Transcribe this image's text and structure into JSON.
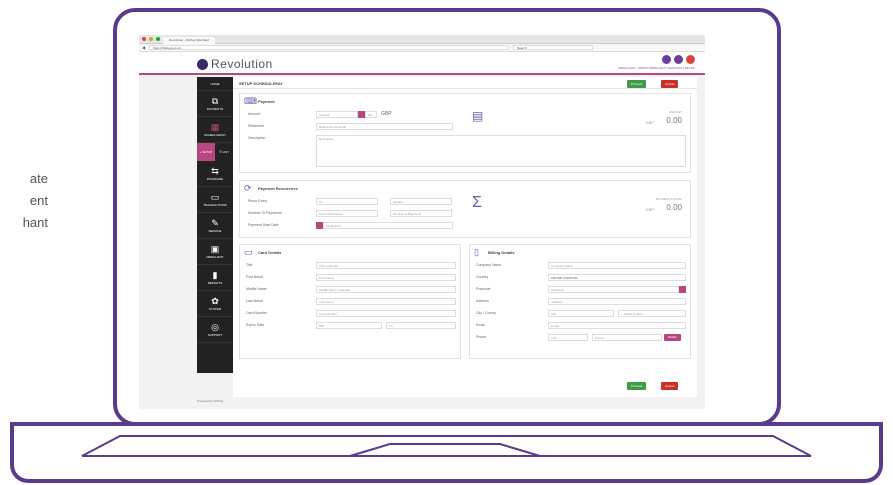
{
  "side_text": {
    "line1": "ate",
    "line2": "ent",
    "line3": "hant"
  },
  "browser": {
    "tab_label": "Revolution - WePay Merchant",
    "url": "https://Webpay.co.uk",
    "search_placeholder": "Search"
  },
  "header": {
    "logo_text": "Revolution",
    "merchant_label": "MERCHANT - WEPAY MERCHANT SERVICES LIMITED"
  },
  "sidebar": {
    "items": [
      {
        "label": "HOME",
        "icon": "home-icon"
      },
      {
        "label": "PAYMENTS",
        "icon": "payments-icon"
      },
      {
        "label": "SCHEDULEPAY",
        "icon": "calendar-icon"
      },
      {
        "label": "SETUP",
        "icon": "plus-icon"
      },
      {
        "label": "LIST",
        "icon": "list-icon"
      },
      {
        "label": "PAYAWARE",
        "icon": "shuffle-icon"
      },
      {
        "label": "TRANSACTIONS",
        "icon": "monitor-icon"
      },
      {
        "label": "SERVICE",
        "icon": "brush-icon"
      },
      {
        "label": "MERCHANT",
        "icon": "store-icon"
      },
      {
        "label": "REPORTS",
        "icon": "chart-icon"
      },
      {
        "label": "SYSTEM",
        "icon": "gear-icon"
      },
      {
        "label": "SUPPORT",
        "icon": "lifebuoy-icon"
      }
    ]
  },
  "page": {
    "title": "SETUP SCHEDULEPAY",
    "proceed": "Proceed",
    "cancel": "Cancel"
  },
  "payment": {
    "title": "Payment",
    "amount_label": "Amount",
    "amount_placeholder": "Amount",
    "decimals": "00",
    "currency": "GBP",
    "reference_label": "Reference",
    "reference_placeholder": "Reference (optional)",
    "description_label": "Description",
    "description_placeholder": "Description",
    "amount_title": "AMOUNT",
    "amount_value": "0.00",
    "amount_currency": "GBP"
  },
  "recurrence": {
    "title": "Payment Recurrence",
    "recur_label": "Recur Every",
    "recur_value": "01",
    "period_value": "Monthly",
    "num_label": "Number Of Payments",
    "num_value": "Fixed Recurrence",
    "num_placeholder": "Number of Payments",
    "start_label": "Payment Start Date",
    "start_value": "06-09-2017",
    "total_title": "PAYMENTS TOTAL",
    "total_value": "0.00",
    "total_currency": "GBP"
  },
  "card": {
    "title": "Card Details",
    "title_label": "Title",
    "title_placeholder": "Title (optional)",
    "first_label": "First Name",
    "first_placeholder": "First Name",
    "middle_label": "Middle Name",
    "middle_placeholder": "Middle Name (optional)",
    "last_label": "Last Name",
    "last_placeholder": "Last Name",
    "number_label": "Card Number",
    "number_placeholder": "Card Number",
    "expiry_label": "Expiry Date",
    "mm_placeholder": "MM",
    "yy_placeholder": "YY"
  },
  "billing": {
    "title": "Billing Details",
    "company_label": "Company Name",
    "company_placeholder": "Company Name",
    "country_label": "Country",
    "country_value": "UNITED KINGDOM",
    "postcode_label": "Postcode",
    "postcode_placeholder": "Postcode",
    "address_label": "Address",
    "address_placeholder": "Address",
    "city_label": "City / County",
    "city_placeholder": "City",
    "county_placeholder": "-- Select County --",
    "email_label": "Email",
    "email_placeholder": "Email",
    "phone_label": "Phone",
    "phone_code": "+44",
    "phone_placeholder": "Phone",
    "mobile_label": "Mobile"
  },
  "footer": {
    "text": "Powered by WePay"
  },
  "colors": {
    "accent": "#b9477f",
    "frame": "#5a3a8c",
    "proceed": "#3f9a4a",
    "cancel": "#c9302c"
  }
}
